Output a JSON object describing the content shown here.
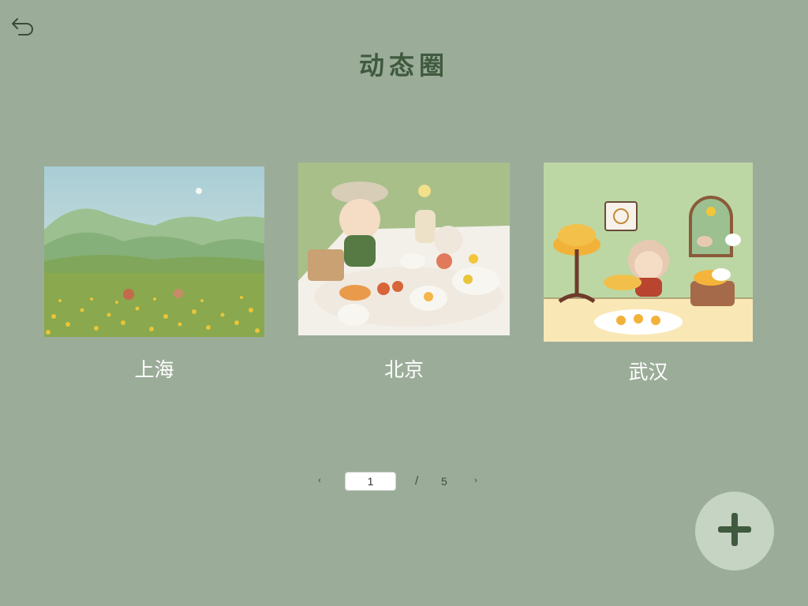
{
  "colors": {
    "background": "#9bad99",
    "title": "#3f5a3e",
    "label": "#ffffff",
    "fab_bg": "#c6d4c4",
    "fab_icon": "#3f5a3e"
  },
  "header": {
    "back_icon": "undo-arrow-icon",
    "title": "动态圈"
  },
  "cards": [
    {
      "label": "上海",
      "image": "mountain-flower-field-illustration"
    },
    {
      "label": "北京",
      "image": "picnic-bear-illustration"
    },
    {
      "label": "武汉",
      "image": "room-bear-hat-illustration"
    }
  ],
  "pagination": {
    "prev_icon": "chevron-left-icon",
    "current_page": "1",
    "separator": "/",
    "total_pages": "5",
    "next_icon": "chevron-right-icon"
  },
  "fab": {
    "icon": "plus-icon"
  }
}
